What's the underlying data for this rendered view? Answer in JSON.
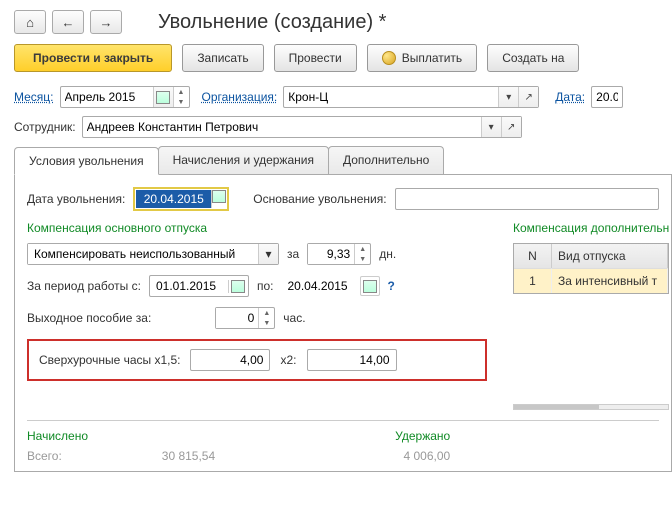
{
  "title": "Увольнение (создание) *",
  "toolbar": {
    "run_close": "Провести и закрыть",
    "save": "Записать",
    "run": "Провести",
    "pay": "Выплатить",
    "create": "Создать на"
  },
  "header": {
    "month_lbl": "Месяц:",
    "month_val": "Апрель 2015",
    "org_lbl": "Организация:",
    "org_val": "Крон-Ц",
    "date_lbl": "Дата:",
    "date_val": "20.0",
    "emp_lbl": "Сотрудник:",
    "emp_val": "Андреев Константин Петрович"
  },
  "tabs": {
    "t1": "Условия увольнения",
    "t2": "Начисления и удержания",
    "t3": "Дополнительно"
  },
  "panel": {
    "fire_date_lbl": "Дата увольнения:",
    "fire_date_val": "20.04.2015",
    "basis_lbl": "Основание увольнения:",
    "comp_main_lbl": "Компенсация основного отпуска",
    "comp_mode": "Компенсировать неиспользованный",
    "for_lbl": "за",
    "days_val": "9,33",
    "days_unit": "дн.",
    "period_lbl": "За период работы с:",
    "period_from": "01.01.2015",
    "period_to_lbl": "по:",
    "period_to": "20.04.2015",
    "help": "?",
    "severance_lbl": "Выходное пособие за:",
    "severance_val": "0",
    "severance_unit": "час.",
    "ot_lbl": "Сверхурочные часы x1,5:",
    "ot15": "4,00",
    "ot2_lbl": "x2:",
    "ot2": "14,00",
    "comp_add_lbl": "Компенсация дополнительн",
    "grid": {
      "col_n": "N",
      "col_v": "Вид отпуска",
      "rows": [
        {
          "n": "1",
          "v": "За интенсивный т"
        }
      ]
    }
  },
  "totals": {
    "accrued_lbl": "Начислено",
    "accrued_row": "Всего:",
    "accrued_val": "30 815,54",
    "withheld_lbl": "Удержано",
    "withheld_val": "4 006,00"
  }
}
